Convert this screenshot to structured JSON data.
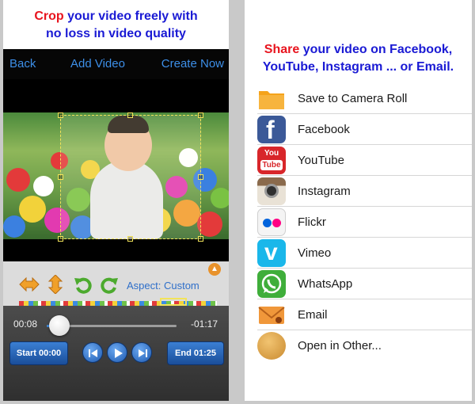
{
  "left_caption": {
    "highlight": "Crop",
    "rest": " your video freely with",
    "line2": "no loss in video quality"
  },
  "nav": {
    "back": "Back",
    "add_video": "Add Video",
    "create_now": "Create Now"
  },
  "tools": {
    "aspect_label": "Aspect: Custom"
  },
  "player": {
    "time_start": "00:08",
    "time_end": "-01:17",
    "start_label": "Start 00:00",
    "end_label": "End 01:25",
    "progress": 0.1
  },
  "right_caption": {
    "highlight": "Share",
    "rest": " your video on Facebook,",
    "line2": "YouTube, Instagram ... or Email."
  },
  "share": {
    "items": [
      {
        "label": "Save to Camera Roll",
        "icon": "folder-icon",
        "color": "#f5a31b"
      },
      {
        "label": "Facebook",
        "icon": "facebook-icon",
        "color": "#3b5998"
      },
      {
        "label": "YouTube",
        "icon": "youtube-icon",
        "color": "#d8262a"
      },
      {
        "label": "Instagram",
        "icon": "instagram-icon",
        "color": "#6b4a32"
      },
      {
        "label": "Flickr",
        "icon": "flickr-icon",
        "color": "#f2f2f2"
      },
      {
        "label": "Vimeo",
        "icon": "vimeo-icon",
        "color": "#1ab7ea"
      },
      {
        "label": "WhatsApp",
        "icon": "whatsapp-icon",
        "color": "#3fae3a"
      },
      {
        "label": "Email",
        "icon": "email-icon",
        "color": "#f0973a"
      },
      {
        "label": "Open in Other...",
        "icon": "open-in-other-icon",
        "color": "#d9a24a"
      }
    ]
  },
  "icon_text": {
    "youtube_top": "You",
    "youtube_bottom": "Tube",
    "facebook_f": "f",
    "vimeo_v": "v"
  }
}
